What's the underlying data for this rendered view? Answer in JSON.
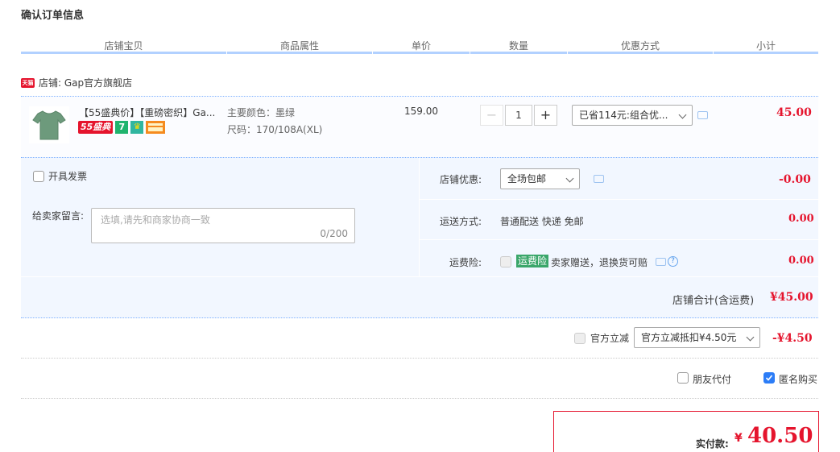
{
  "title": "确认订单信息",
  "columns": [
    "店铺宝贝",
    "商品属性",
    "单价",
    "数量",
    "优惠方式",
    "小计"
  ],
  "shop": {
    "badge": "天猫",
    "label": "店铺: Gap官方旗舰店"
  },
  "item": {
    "name": "【55盛典价】【重磅密织】Ga...",
    "tag_text": "55盛典",
    "tag_7": "7",
    "color_label": "主要颜色：墨绿",
    "size_label": "尺码：170/108A(XL)",
    "price": "159.00",
    "quantity": "1",
    "qty_minus": "−",
    "qty_plus": "+",
    "discount_select": "已省114元:组合优...",
    "subtotal": "45.00"
  },
  "invoice": {
    "label": "开具发票",
    "checked": false
  },
  "message": {
    "label": "给卖家留言:",
    "placeholder": "选填,请先和商家协商一致",
    "counter": "0/200"
  },
  "shop_discount": {
    "label": "店铺优惠:",
    "value": "全场包邮",
    "amount": "-0.00"
  },
  "shipping": {
    "label": "运送方式:",
    "value": "普通配送 快递 免邮",
    "amount": "0.00"
  },
  "insurance": {
    "label": "运费险:",
    "badge": "运费险",
    "text": "卖家赠送，退换货可赔",
    "amount": "0.00"
  },
  "shop_total": {
    "label": "店铺合计(含运费)",
    "amount": "¥45.00"
  },
  "official_discount": {
    "label": "官方立减",
    "select": "官方立减抵扣¥4.50元",
    "amount": "-¥4.50"
  },
  "friend_pay": {
    "label": "朋友代付",
    "checked": false
  },
  "anonymous": {
    "label": "匿名购买",
    "checked": true
  },
  "payment": {
    "label": "实付款:",
    "currency": "¥",
    "amount": "40.50"
  },
  "colors": {
    "accent_red": "#e5142d",
    "header_line": "#b2d1ff",
    "band": "#f2f7ff",
    "badge_green": "#3aa66a"
  }
}
